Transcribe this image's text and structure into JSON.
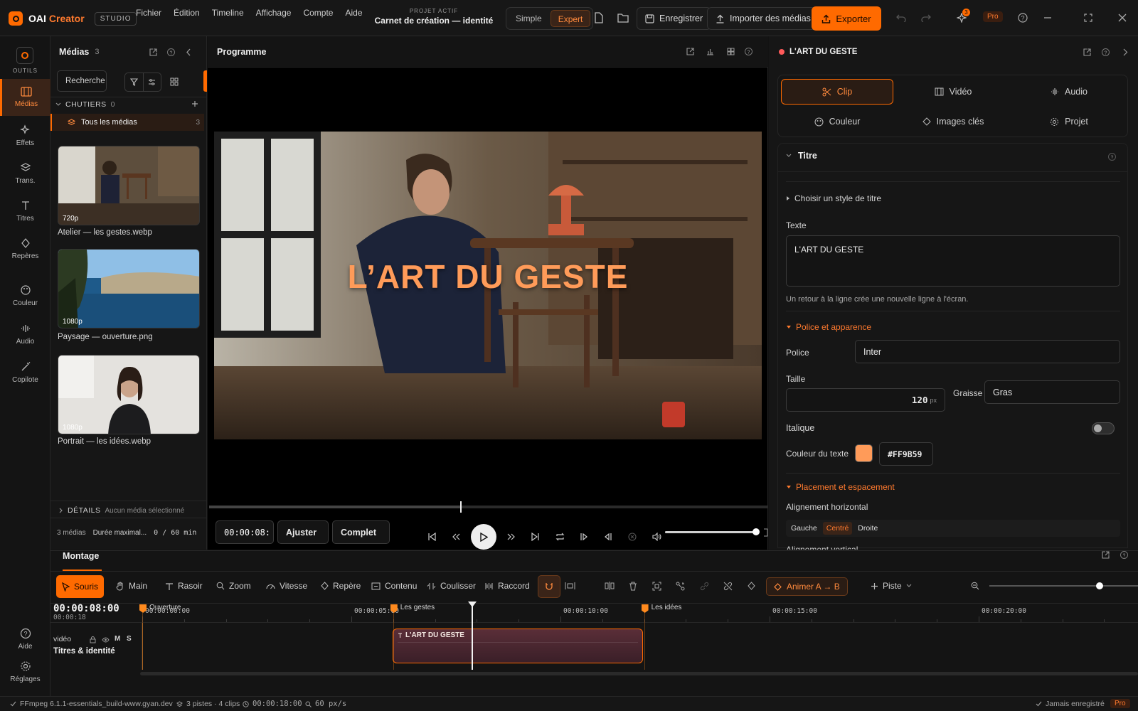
{
  "app": {
    "brand_a": "OAI",
    "brand_b": "Creator",
    "badge": "STUDIO"
  },
  "menu": [
    "Fichier",
    "Édition",
    "Timeline",
    "Affichage",
    "Compte",
    "Aide"
  ],
  "project": {
    "kicker": "PROJET ACTIF",
    "name": "Carnet de création — identité"
  },
  "mode": {
    "simple": "Simple",
    "expert": "Expert"
  },
  "actions": {
    "save": "Enregistrer",
    "import": "Importer des médias",
    "export": "Exporter",
    "notif_count": "3",
    "pro": "Pro"
  },
  "rail": {
    "tools": "OUTILS",
    "items": [
      "Médias",
      "Effets",
      "Trans.",
      "Titres",
      "Repères",
      "Couleur",
      "Audio",
      "Copilote"
    ],
    "help": "Aide",
    "settings": "Réglages"
  },
  "media": {
    "title": "Médias",
    "count": "3",
    "search": "Recherche",
    "bins_label": "CHUTIERS",
    "bins_count": "0",
    "all_media": "Tous les médias",
    "all_count": "3",
    "items": [
      {
        "res": "720p",
        "name": "Atelier — les gestes.webp"
      },
      {
        "res": "1080p",
        "name": "Paysage — ouverture.png"
      },
      {
        "res": "1080p",
        "name": "Portrait — les idées.webp"
      }
    ],
    "details_label": "DÉTAILS",
    "details_value": "Aucun média sélectionné",
    "footer_count": "3 médias",
    "footer_duration": "Durée maximal...",
    "footer_usage": "0 / 60 min"
  },
  "program": {
    "title": "Programme",
    "overlay": "L’ART DU GESTE",
    "timecode": "00:00:08:",
    "fit": "Ajuster",
    "quality": "Complet",
    "scrub_progress": 0.45,
    "volume": 1.0
  },
  "inspector": {
    "clip_name": "L'ART DU GESTE",
    "tabs": [
      "Clip",
      "Vidéo",
      "Audio",
      "Couleur",
      "Images clés",
      "Projet"
    ],
    "section": "Titre",
    "style_picker": "Choisir un style de titre",
    "text_label": "Texte",
    "text_value": "L'ART DU GESTE",
    "text_hint": "Un retour à la ligne crée une nouvelle ligne à l'écran.",
    "font_section": "Police et apparence",
    "font_label": "Police",
    "font_value": "Inter",
    "size_label": "Taille",
    "size_value": "120",
    "size_unit": "px",
    "weight_label": "Graisse",
    "weight_value": "Gras",
    "italic_label": "Italique",
    "italic_on": false,
    "color_label": "Couleur du texte",
    "color_value": "#FF9B59",
    "placement_section": "Placement et espacement",
    "halign_label": "Alignement horizontal",
    "halign_options": [
      "Gauche",
      "Centré",
      "Droite"
    ],
    "halign_selected": "Centré",
    "valign_label": "Alignement vertical"
  },
  "montage": {
    "tab": "Montage",
    "tools": [
      "Souris",
      "Main",
      "Rasoir",
      "Zoom",
      "Vitesse",
      "Repère",
      "Contenu",
      "Coulisser",
      "Raccord"
    ],
    "animate": "Animer A → B",
    "track_btn": "Piste",
    "timecode": "00:00:08:00",
    "timecode_sub": "00:00:18",
    "ruler": [
      "00:00:00:00",
      "00:00:05:00",
      "00:00:10:00",
      "00:00:15:00",
      "00:00:20:00"
    ],
    "markers": [
      "Ouverture",
      "Les gestes",
      "Les idées"
    ],
    "track_kind": "vidéo",
    "track_flags": [
      "M",
      "S"
    ],
    "track_name": "Titres & identité",
    "clip_label": "L'ART DU GESTE",
    "zoom_level": 0.74
  },
  "status": {
    "ffmpeg": "FFmpeg 6.1.1-essentials_build-www.gyan.dev",
    "tracks": "3 pistes · 4 clips",
    "duration": "00:00:18:00",
    "scale": "60 px/s",
    "saved": "Jamais enregistré",
    "pro": "Pro"
  },
  "colors": {
    "accent": "#FF6A00",
    "accent_soft": "#FF9B59",
    "panel": "#161616",
    "border": "#2A2A2A"
  }
}
